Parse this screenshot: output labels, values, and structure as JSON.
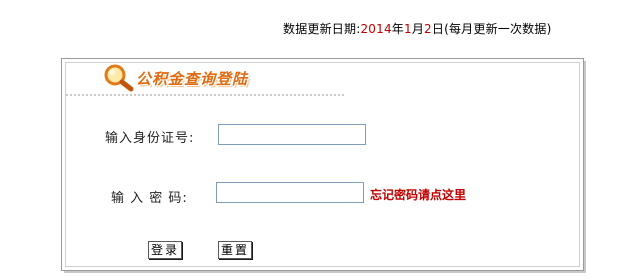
{
  "update_notice": {
    "prefix": "数据更新日期:",
    "year": "2014",
    "year_unit": "年",
    "month": "1",
    "month_unit": "月",
    "day": "2",
    "day_unit": "日",
    "note": "(每月更新一次数据)"
  },
  "panel": {
    "title": "公积金查询登陆",
    "title_icon": "magnifier-icon"
  },
  "form": {
    "id_label": "输入身份证号:",
    "id_value": "",
    "password_label": "输 入 密 码:",
    "password_value": "",
    "forgot_link": "忘记密码请点这里",
    "login_button": "登录",
    "reset_button": "重置"
  },
  "colors": {
    "date_highlight": "#c00000",
    "title": "#e06b12",
    "forgot_link": "#c00000"
  }
}
